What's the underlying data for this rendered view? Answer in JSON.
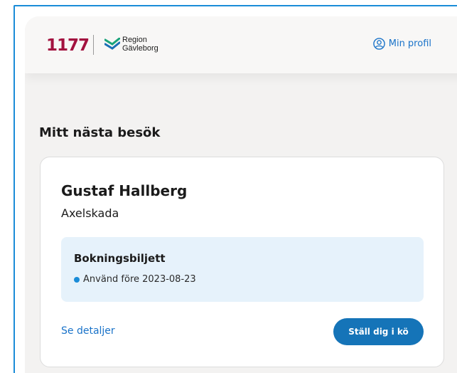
{
  "header": {
    "logo_text": "1177",
    "region_line1": "Region",
    "region_line2": "Gävleborg",
    "profile_label": "Min profil"
  },
  "main": {
    "section_title": "Mitt nästa besök",
    "visit": {
      "doctor_name": "Gustaf Hallberg",
      "reason": "Axelskada",
      "ticket_title": "Bokningsbiljett",
      "ticket_status": "Använd före 2023-08-23",
      "details_link": "Se detaljer",
      "queue_button": "Ställ dig i kö"
    }
  },
  "colors": {
    "brand_1177": "#a3123f",
    "link_blue": "#1a73c9",
    "button_blue": "#1574b8",
    "ticket_bg": "#e6f2fb",
    "status_dot": "#1a8cd8"
  },
  "icons": {
    "profile": "user-circle-icon",
    "region": "region-logo-icon",
    "status": "status-dot-icon"
  }
}
